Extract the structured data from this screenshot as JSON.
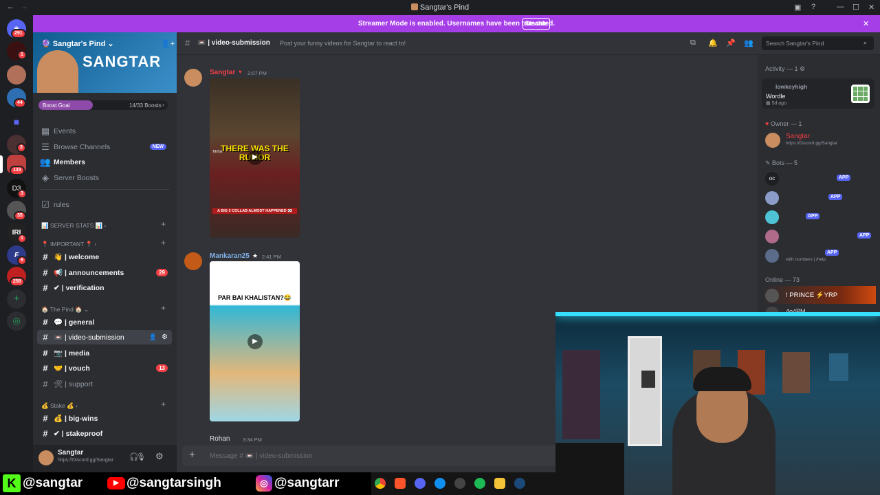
{
  "titlebar": {
    "title": "Sangtar's Pind"
  },
  "rail": {
    "badges": [
      "291",
      "1",
      "44",
      "3",
      "133",
      "3",
      "35",
      "1",
      "6",
      "258"
    ],
    "labels": [
      "D3",
      "IRI",
      "F"
    ]
  },
  "streamer": {
    "message": "Streamer Mode is enabled. Usernames have been truncated.",
    "disable_label": "Disable"
  },
  "server": {
    "name": "Sangtar's Pind",
    "banner_text": "SANGTAR",
    "boost_goal_label": "Boost Goal",
    "boost_count": "14/33 Boosts",
    "boost_progress": 0.42,
    "nav": [
      {
        "label": "Events"
      },
      {
        "label": "Browse Channels",
        "badge": "NEW"
      },
      {
        "label": "Members"
      },
      {
        "label": "Server Boosts"
      }
    ],
    "rules_label": "rules",
    "categories": {
      "stats": "📊 SERVER STATS 📊",
      "important": "📍 IMPORTANT 📍",
      "pind": "🏠 The Pind 🏠",
      "stake": "💰 Stake 💰"
    },
    "channels": [
      {
        "name": "👋 | welcome"
      },
      {
        "name": "📢 | announcements",
        "badge": "29"
      },
      {
        "name": "✔ | verification"
      },
      {
        "name": "💬 | general"
      },
      {
        "name": "📼 | video-submission"
      },
      {
        "name": "📷 | media"
      },
      {
        "name": "🤝 | vouch",
        "badge": "13"
      },
      {
        "name": "🛠 | support"
      },
      {
        "name": "💰 | big-wins"
      },
      {
        "name": "✔ | stakeproof"
      }
    ]
  },
  "user": {
    "name": "Sangtar",
    "status": "https://Discord.gg/Sangtar"
  },
  "header": {
    "channel": "📼 | video-submission",
    "topic": "Post your funny videos for Sangtar to react to!",
    "search_placeholder": "Search Sangtar's Pind"
  },
  "messages": [
    {
      "author": "Sangtar",
      "time": "2:07 PM",
      "caption": "THERE WAS THE RUMOR",
      "subcaption": "A BIG 3 COLLAB ALMOST HAPPENED 👀",
      "tiktok": "TikTok"
    },
    {
      "author": "Mankaran25",
      "time": "2:41 PM",
      "caption": "PAR BAI KHALISTAN?😂"
    },
    {
      "author": "Rohan",
      "time": "3:34 PM"
    }
  ],
  "composer": {
    "placeholder": "Message # 📼 | video-submission"
  },
  "members": {
    "activity_header": "Activity — 1",
    "activity_user": "lowkeyhigh",
    "activity_game": "Wordle",
    "activity_time": "5d ago",
    "owner_header": "Owner — 1",
    "owner_name": "Sangtar",
    "owner_status": "https://Discord.gg/Sangtar",
    "bots_header": "Bots — 5",
    "app_label": "APP",
    "bot5_status": "with numbers | /help",
    "online_header": "Online — 73",
    "online_1": "! PRINCE ⚡YRP",
    "online_2": "4o4PM"
  },
  "social": {
    "kick": "@sangtar",
    "youtube": "@sangtarsingh",
    "instagram": "@sangtarr"
  },
  "colors": {
    "accent": "#a63ee8",
    "blurple": "#5865f2",
    "red": "#f23f43",
    "owner": "#f23f43"
  }
}
